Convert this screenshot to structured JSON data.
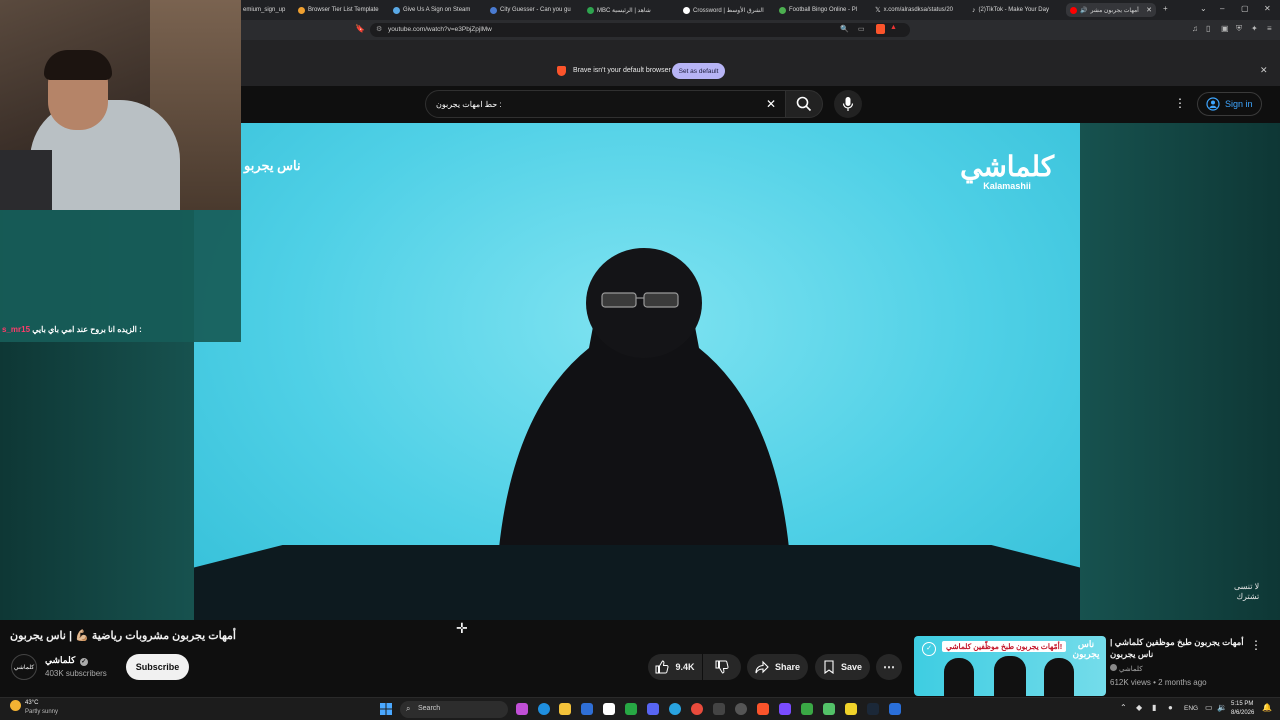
{
  "browser": {
    "tabs": [
      {
        "label": "emium_sign_up",
        "color": "#888888"
      },
      {
        "label": "Browser Tier List Template",
        "color": "#f0a030"
      },
      {
        "label": "Give Us A Sign on Steam",
        "color": "#5aa9e6"
      },
      {
        "label": "City Guesser - Can you gu",
        "color": "#4a7bd1"
      },
      {
        "label": "MBC شاهد | الرئيسية",
        "color": "#2ea44f"
      },
      {
        "label": "Crossword | الشرق الأوسط",
        "color": "#ffffff"
      },
      {
        "label": "Football Bingo Online - Pl",
        "color": "#4caf50"
      },
      {
        "label": "x.com/alrasdksa/status/20",
        "color": "#ffffff"
      },
      {
        "label": "(2)TikTok - Make Your Day",
        "color": "#ffffff"
      },
      {
        "label": "أمهات يجربون مشر",
        "color": "#ff0000"
      }
    ],
    "url": "youtube.com/watch?v=e3PbjZpjlMw",
    "notice": {
      "text": "Brave isn't your default browser",
      "button": "Set as default"
    }
  },
  "youtube": {
    "search_value": "حط امهات يجربون :",
    "signin_label": "Sign in",
    "video": {
      "channel_overlay_left": "ناس يجربو",
      "watermark_ar": "كلماشي",
      "watermark_en": "Kalamashii",
      "corner_text_line1": "لا تنسى",
      "corner_text_line2": "تشترك"
    },
    "title": "أمهات يجربون مشروبات رياضية 💪🏼 | ناس يجربون",
    "channel": {
      "name": "كلماشي",
      "subscribers": "403K subscribers",
      "logo_text": "كلماشي"
    },
    "subscribe_label": "Subscribe",
    "likes": "9.4K",
    "share_label": "Share",
    "save_label": "Save",
    "recommended": {
      "title": "أمهات يجربون طبخ موظفين كلماشي | ناس يجربون",
      "channel": "كلماشي",
      "meta": "612K views • 2 months ago",
      "thumb_banner": "أمّهات يجربون طبخ موظّفين كلماشي!",
      "thumb_logo": "ناس يجربون"
    }
  },
  "stream": {
    "chat_user": "s_mr15",
    "chat_message": "الزيده انا بروح عند امي باي بايي :"
  },
  "taskbar": {
    "weather_temp": "43°C",
    "weather_text": "Partly sunny",
    "search_placeholder": "Search",
    "lang": "ENG",
    "time": "5:15 PM",
    "date": "8/6/2026"
  }
}
